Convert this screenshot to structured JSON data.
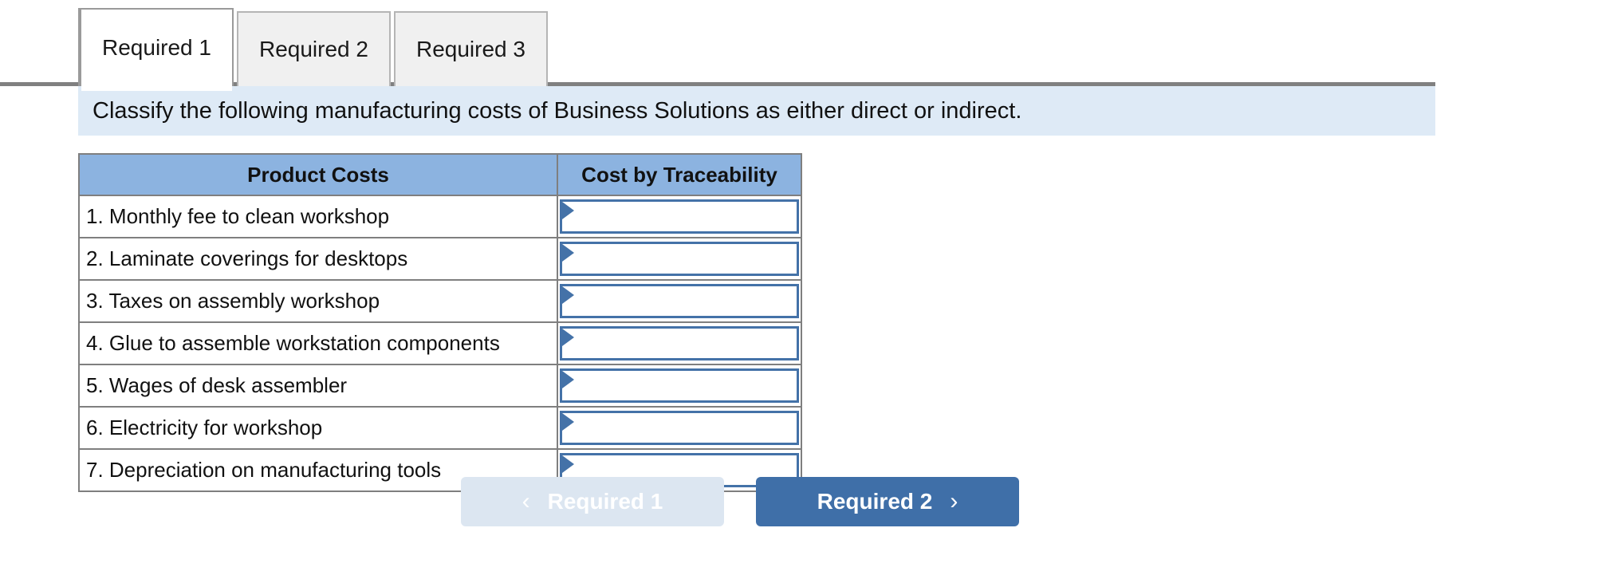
{
  "tabs": [
    {
      "label": "Required 1",
      "active": true
    },
    {
      "label": "Required 2",
      "active": false
    },
    {
      "label": "Required 3",
      "active": false
    }
  ],
  "instruction": {
    "text": "Classify the following manufacturing costs of Business Solutions as either direct or indirect."
  },
  "table": {
    "headers": {
      "col1": "Product Costs",
      "col2": "Cost by Traceability"
    },
    "rows": [
      {
        "label": "1. Monthly fee to clean workshop",
        "value": ""
      },
      {
        "label": "2. Laminate coverings for desktops",
        "value": ""
      },
      {
        "label": "3. Taxes on assembly workshop",
        "value": ""
      },
      {
        "label": "4. Glue to assemble workstation components",
        "value": ""
      },
      {
        "label": "5. Wages of desk assembler",
        "value": ""
      },
      {
        "label": "6. Electricity for workshop",
        "value": ""
      },
      {
        "label": "7. Depreciation on manufacturing tools",
        "value": ""
      }
    ]
  },
  "footer": {
    "prev_label": "Required 1",
    "next_label": "Required 2",
    "prev_icon": "chevron-left-icon",
    "next_icon": "chevron-right-icon",
    "prev_chevron": "‹",
    "next_chevron": "›"
  },
  "colors": {
    "header_blue": "#8CB3E0",
    "instruction_bg": "#DEEAF6",
    "dropdown_border": "#4472A8",
    "next_button": "#3F6FA8",
    "prev_button": "#DCE6F1",
    "table_border": "#7F7F7F"
  }
}
